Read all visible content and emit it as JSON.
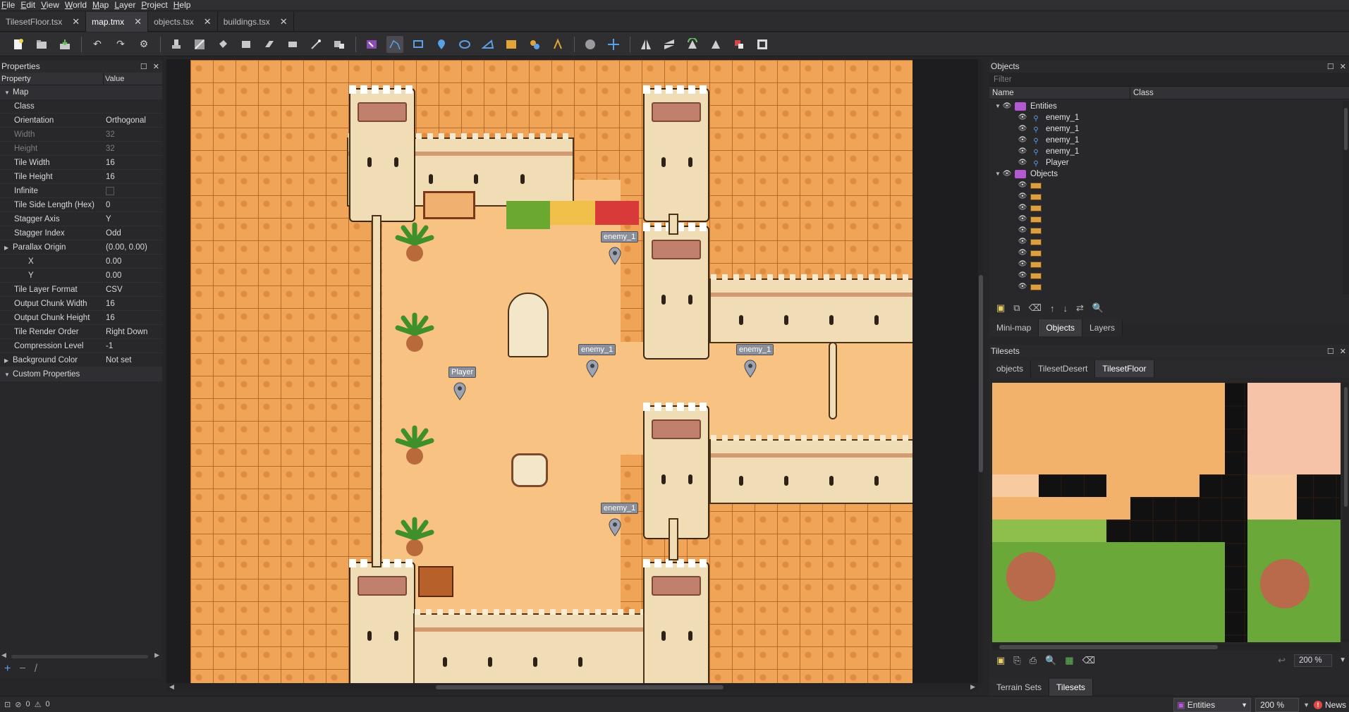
{
  "menu": [
    "File",
    "Edit",
    "View",
    "World",
    "Map",
    "Layer",
    "Project",
    "Help"
  ],
  "tabs": [
    {
      "label": "TilesetFloor.tsx",
      "active": false
    },
    {
      "label": "map.tmx",
      "active": true
    },
    {
      "label": "objects.tsx",
      "active": false
    },
    {
      "label": "buildings.tsx",
      "active": false
    }
  ],
  "toolbar_icons": [
    "new-map",
    "open",
    "save",
    "undo",
    "redo",
    "commands",
    "stamp-brush",
    "terrain-brush",
    "bucket-fill",
    "shape-fill",
    "eraser",
    "rect-select",
    "magic-wand",
    "select-same",
    "select-objects",
    "edit-polygons",
    "insert-rectangle",
    "insert-point",
    "insert-ellipse",
    "insert-polygon",
    "insert-tile",
    "insert-template",
    "insert-text",
    "world-tool",
    "move-map",
    "flip-horizontal",
    "flip-vertical",
    "rotate-left",
    "rotate-right",
    "random-mode",
    "wang-fill"
  ],
  "properties": {
    "title": "Properties",
    "col_property": "Property",
    "col_value": "Value",
    "rows": [
      {
        "k": "Map",
        "v": "",
        "type": "group"
      },
      {
        "k": "Class",
        "v": "",
        "type": "row"
      },
      {
        "k": "Orientation",
        "v": "Orthogonal",
        "type": "row"
      },
      {
        "k": "Width",
        "v": "32",
        "type": "dis"
      },
      {
        "k": "Height",
        "v": "32",
        "type": "dis"
      },
      {
        "k": "Tile Width",
        "v": "16",
        "type": "row"
      },
      {
        "k": "Tile Height",
        "v": "16",
        "type": "row"
      },
      {
        "k": "Infinite",
        "v": "",
        "type": "check"
      },
      {
        "k": "Tile Side Length (Hex)",
        "v": "0",
        "type": "row"
      },
      {
        "k": "Stagger Axis",
        "v": "Y",
        "type": "row"
      },
      {
        "k": "Stagger Index",
        "v": "Odd",
        "type": "row"
      },
      {
        "k": "Parallax Origin",
        "v": "(0.00, 0.00)",
        "type": "expand"
      },
      {
        "k": "X",
        "v": "0.00",
        "type": "sub"
      },
      {
        "k": "Y",
        "v": "0.00",
        "type": "sub"
      },
      {
        "k": "Tile Layer Format",
        "v": "CSV",
        "type": "row"
      },
      {
        "k": "Output Chunk Width",
        "v": "16",
        "type": "row"
      },
      {
        "k": "Output Chunk Height",
        "v": "16",
        "type": "row"
      },
      {
        "k": "Tile Render Order",
        "v": "Right Down",
        "type": "row"
      },
      {
        "k": "Compression Level",
        "v": "-1",
        "type": "row"
      },
      {
        "k": "Background Color",
        "v": "Not set",
        "type": "expand"
      },
      {
        "k": "Custom Properties",
        "v": "",
        "type": "group"
      }
    ]
  },
  "map_objects": [
    {
      "label": "enemy_1"
    },
    {
      "label": "enemy_1"
    },
    {
      "label": "enemy_1"
    },
    {
      "label": "Player"
    },
    {
      "label": "enemy_1"
    }
  ],
  "objects_panel": {
    "title": "Objects",
    "filter_placeholder": "Filter",
    "col_name": "Name",
    "col_class": "Class",
    "entities_layer": "Entities",
    "entities": [
      "enemy_1",
      "enemy_1",
      "enemy_1",
      "enemy_1",
      "Player"
    ],
    "objects_layer": "Objects",
    "object_count": 10
  },
  "panel_tabs": [
    "Mini-map",
    "Objects",
    "Layers"
  ],
  "tilesets_panel": {
    "title": "Tilesets",
    "tabs": [
      "objects",
      "TilesetDesert",
      "TilesetFloor"
    ],
    "active_tab": "TilesetFloor",
    "zoom": "200 %"
  },
  "bottom_tabs": [
    "Terrain Sets",
    "Tilesets"
  ],
  "status": {
    "errors": "0",
    "warnings": "0",
    "current_layer": "Entities",
    "zoom": "200 %",
    "news": "News"
  },
  "colors": {
    "accent": "#5aa0e6",
    "sand": "#f0a458",
    "wall": "#f0dcb5"
  }
}
